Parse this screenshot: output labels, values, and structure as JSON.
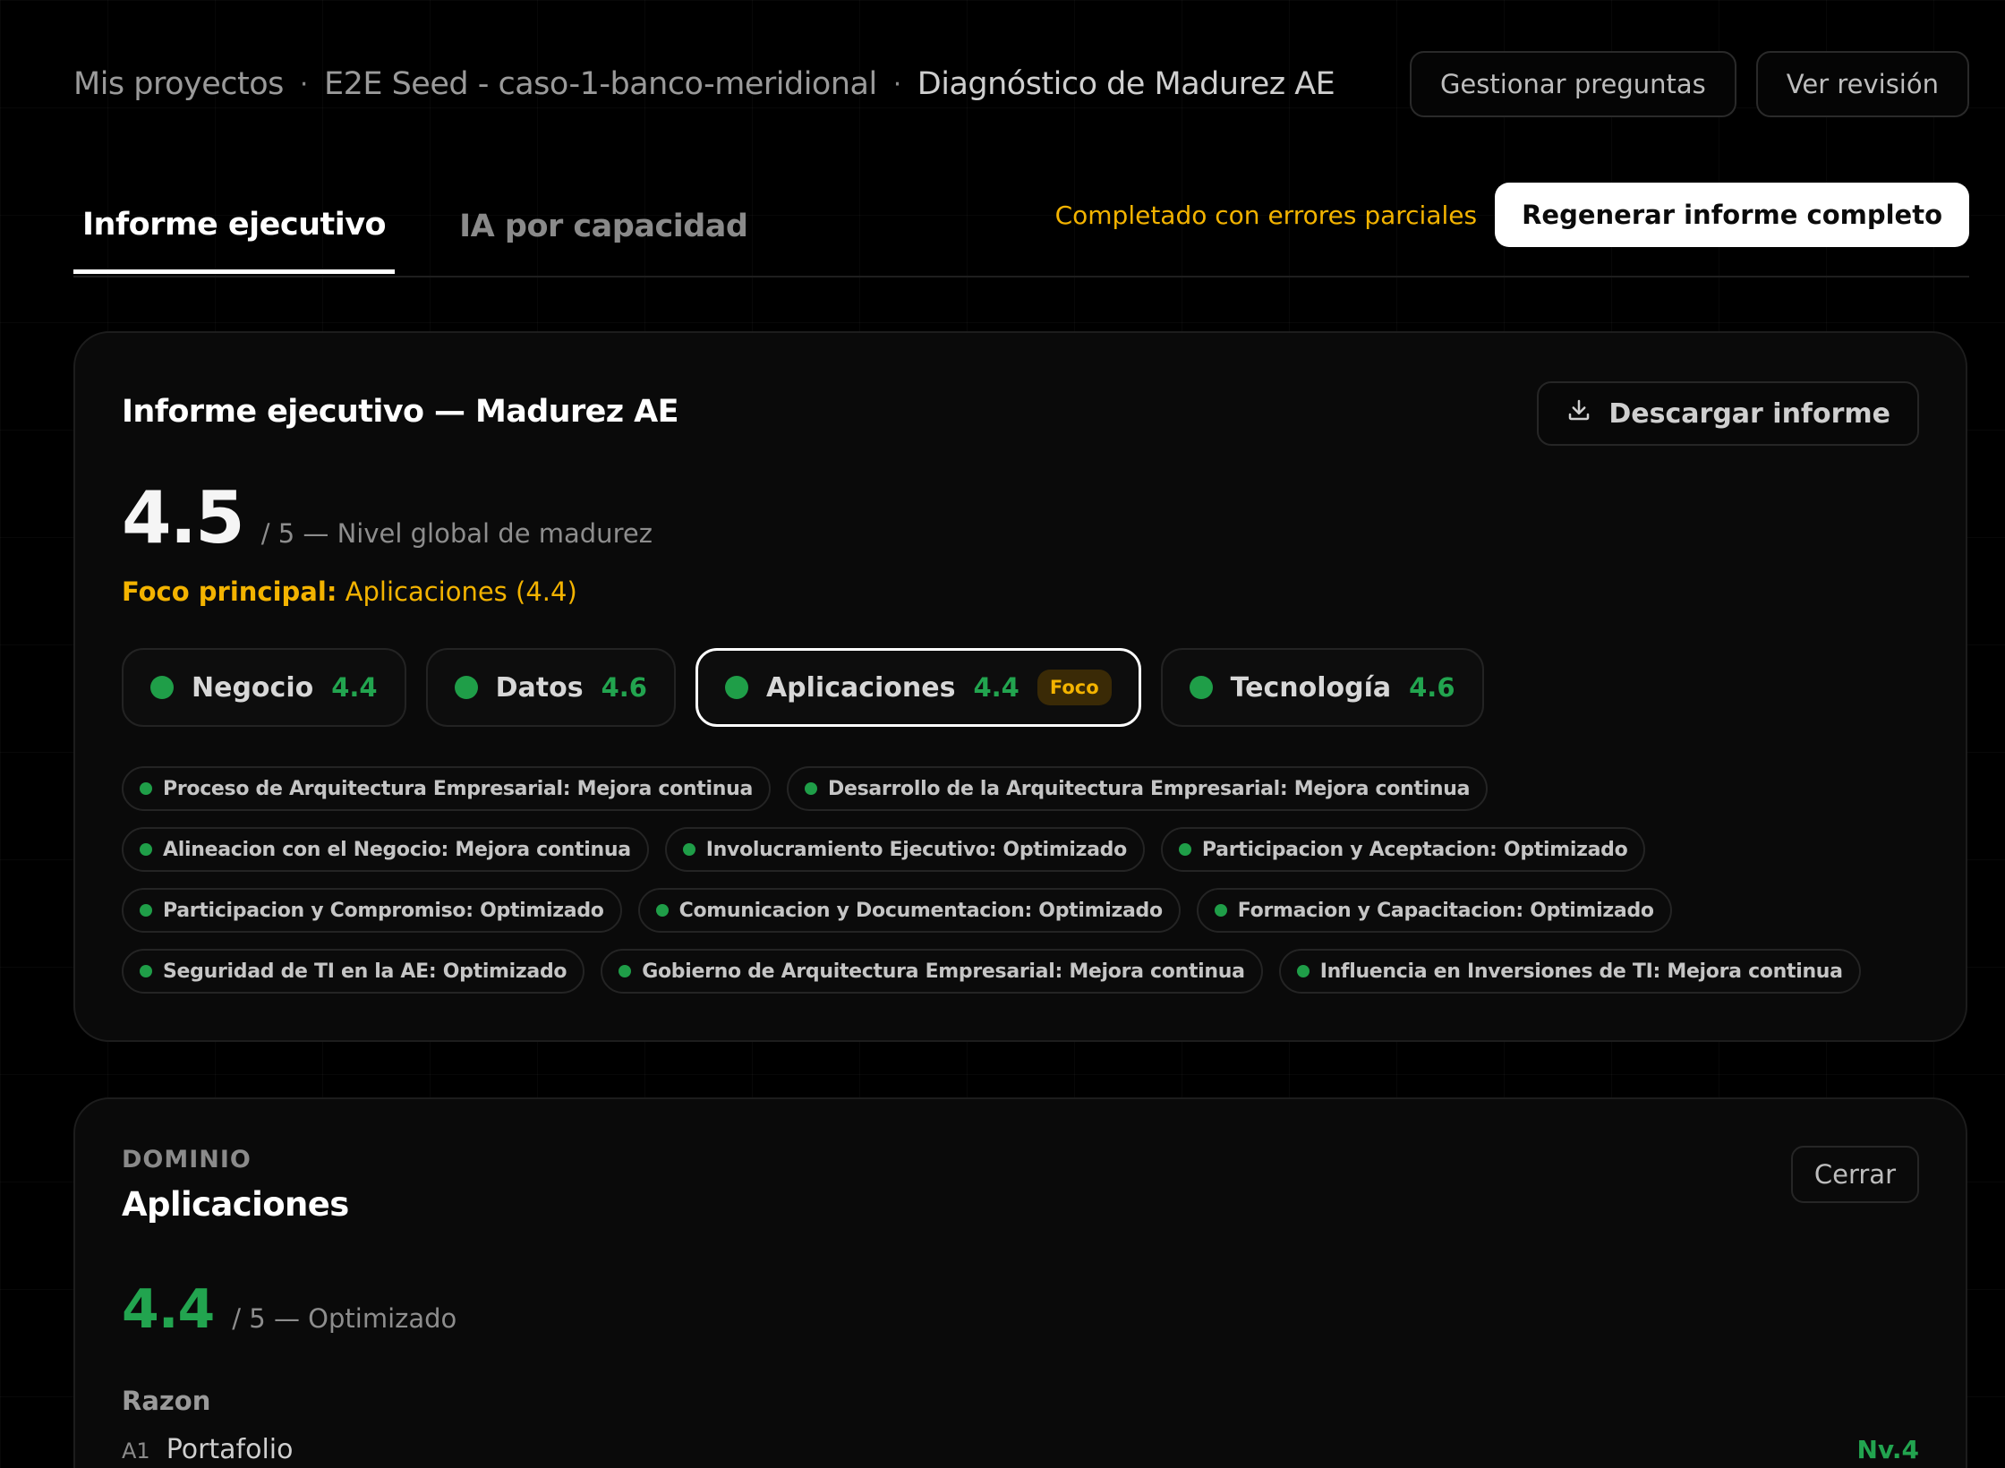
{
  "breadcrumb": {
    "items": [
      "Mis proyectos",
      "E2E Seed - caso-1-banco-meridional",
      "Diagnóstico de Madurez AE"
    ],
    "separator": "·"
  },
  "header_actions": {
    "manage_questions": "Gestionar preguntas",
    "view_review": "Ver revisión"
  },
  "tabs": [
    {
      "label": "Informe ejecutivo",
      "active": true
    },
    {
      "label": "IA por capacidad",
      "active": false
    }
  ],
  "generation": {
    "status": "Completado con errores parciales",
    "regenerate_label": "Regenerar informe completo"
  },
  "report": {
    "title": "Informe ejecutivo — Madurez AE",
    "download_label": "Descargar informe",
    "overall_score": "4.5",
    "overall_subtitle": "/ 5 — Nivel global de madurez",
    "focus_label": "Foco principal:",
    "focus_value": "Aplicaciones (4.4)",
    "domains": [
      {
        "name": "Negocio",
        "score": "4.4",
        "active": false,
        "badge": ""
      },
      {
        "name": "Datos",
        "score": "4.6",
        "active": false,
        "badge": ""
      },
      {
        "name": "Aplicaciones",
        "score": "4.4",
        "active": true,
        "badge": "Foco"
      },
      {
        "name": "Tecnología",
        "score": "4.6",
        "active": false,
        "badge": ""
      }
    ],
    "capabilities": [
      "Proceso de Arquitectura Empresarial: Mejora continua",
      "Desarrollo de la Arquitectura Empresarial: Mejora continua",
      "Alineacion con el Negocio: Mejora continua",
      "Involucramiento Ejecutivo: Optimizado",
      "Participacion y Aceptacion: Optimizado",
      "Participacion y Compromiso: Optimizado",
      "Comunicacion y Documentacion: Optimizado",
      "Formacion y Capacitacion: Optimizado",
      "Seguridad de TI en la AE: Optimizado",
      "Gobierno de Arquitectura Empresarial: Mejora continua",
      "Influencia en Inversiones de TI: Mejora continua"
    ]
  },
  "domain_detail": {
    "eyebrow": "DOMINIO",
    "title": "Aplicaciones",
    "close_label": "Cerrar",
    "score": "4.4",
    "score_subtitle": "/ 5 — Optimizado",
    "reason_label": "Razon",
    "items": [
      {
        "code": "A1",
        "name": "Portafolio",
        "level": "Nv.4"
      }
    ]
  },
  "colors": {
    "accent_green": "#22a44f",
    "warning_amber": "#f3b300",
    "background": "#000000"
  },
  "icons": {
    "download": "download-icon",
    "status_dot": "status-dot-icon"
  }
}
